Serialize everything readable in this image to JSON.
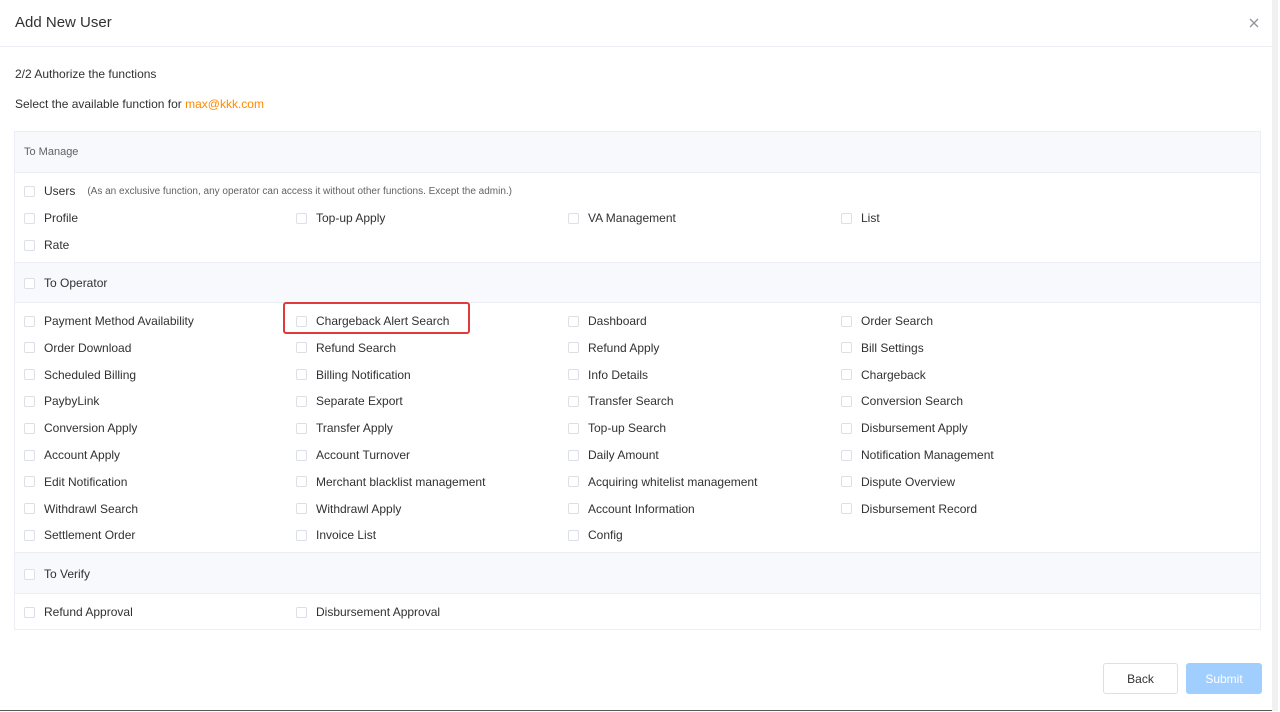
{
  "dialog": {
    "title": "Add New User",
    "step": "2/2 Authorize the functions",
    "subtitle_prefix": "Select the available function for",
    "email": "max@kkk.com"
  },
  "manage": {
    "header": "To Manage",
    "users_label": "Users",
    "users_note": "(As an exclusive function, any operator can access it without other functions. Except the admin.)",
    "items": [
      "Profile",
      "Top-up Apply",
      "VA Management",
      "List",
      "Rate"
    ]
  },
  "operator": {
    "header": "To Operator",
    "items": [
      "Payment Method Availability",
      "Chargeback Alert Search",
      "Dashboard",
      "Order Search",
      "Order Download",
      "Refund Search",
      "Refund Apply",
      "Bill Settings",
      "Scheduled Billing",
      "Billing Notification",
      "Info Details",
      "Chargeback",
      "PaybyLink",
      "Separate Export",
      "Transfer Search",
      "Conversion Search",
      "Conversion Apply",
      "Transfer Apply",
      "Top-up Search",
      "Disbursement Apply",
      "Account Apply",
      "Account Turnover",
      "Daily Amount",
      "Notification Management",
      "Edit Notification",
      "Merchant blacklist management",
      "Acquiring whitelist management",
      "Dispute Overview",
      "Withdrawl Search",
      "Withdrawl Apply",
      "Account Information",
      "Disbursement Record",
      "Settlement Order",
      "Invoice List",
      "Config"
    ]
  },
  "verify": {
    "header": "To Verify",
    "items": [
      "Refund Approval",
      "Disbursement Approval"
    ]
  },
  "footer": {
    "back_label": "Back",
    "submit_label": "Submit"
  },
  "colors": {
    "accent": "#ff8a00",
    "highlight": "#e03b3b",
    "submit_disabled": "#a0cfff"
  }
}
